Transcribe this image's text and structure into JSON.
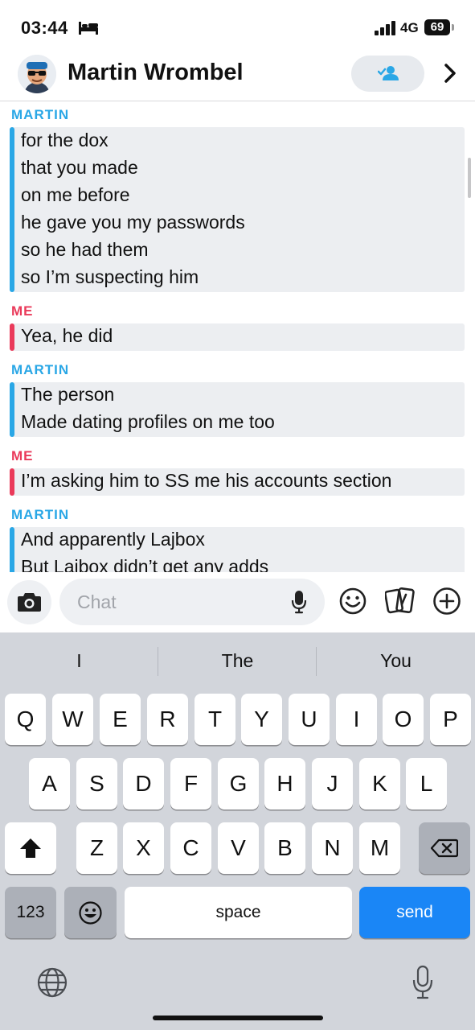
{
  "status_bar": {
    "time": "03:44",
    "network": "4G",
    "battery": "69"
  },
  "header": {
    "contact_name": "Martin Wrombel"
  },
  "messages": [
    {
      "sender": "MARTIN",
      "lines": [
        "for the dox",
        "that you made",
        "on me before",
        "he gave you my passwords",
        "so he had them",
        "so I’m suspecting him"
      ]
    },
    {
      "sender": "ME",
      "lines": [
        "Yea, he did"
      ]
    },
    {
      "sender": "MARTIN",
      "lines": [
        "The person",
        "Made dating profiles on me too"
      ]
    },
    {
      "sender": "ME",
      "lines": [
        "I’m asking him to SS me his accounts section"
      ]
    },
    {
      "sender": "MARTIN",
      "lines": [
        "And apparently Lajbox",
        "But Lajbox didn’t get any adds"
      ]
    }
  ],
  "input": {
    "placeholder": "Chat"
  },
  "keyboard": {
    "suggestions": [
      "I",
      "The",
      "You"
    ],
    "row1": [
      "Q",
      "W",
      "E",
      "R",
      "T",
      "Y",
      "U",
      "I",
      "O",
      "P"
    ],
    "row2": [
      "A",
      "S",
      "D",
      "F",
      "G",
      "H",
      "J",
      "K",
      "L"
    ],
    "row3": [
      "Z",
      "X",
      "C",
      "V",
      "B",
      "N",
      "M"
    ],
    "numbers_label": "123",
    "space_label": "space",
    "send_label": "send"
  },
  "colors": {
    "martin": "#2aa7e6",
    "me": "#ea3a5a",
    "send_key": "#1a86f6"
  },
  "icons": [
    "bed-icon",
    "signal-icon",
    "add-friend-icon",
    "chevron-right-icon",
    "camera-icon",
    "microphone-icon",
    "emoji-icon",
    "sticker-cards-icon",
    "plus-circle-icon",
    "shift-icon",
    "backspace-icon",
    "emoji-face-icon",
    "globe-icon",
    "dictation-mic-icon"
  ]
}
